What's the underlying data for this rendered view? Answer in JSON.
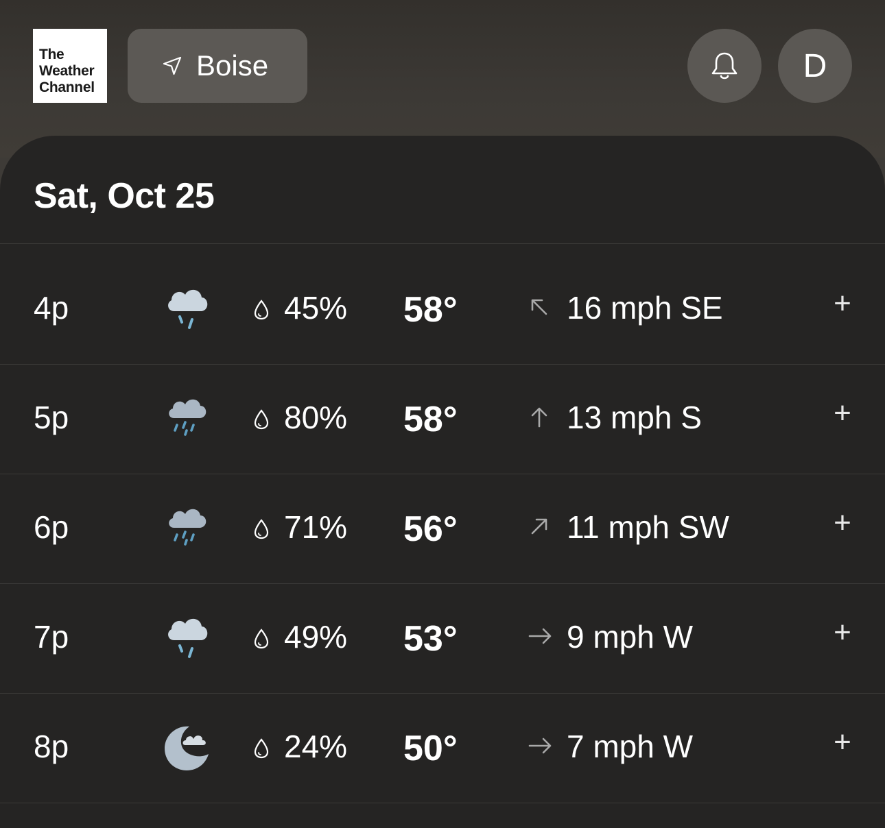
{
  "header": {
    "logo_lines": [
      "The",
      "Weather",
      "Channel"
    ],
    "location": "Boise",
    "avatar_initial": "D"
  },
  "forecast": {
    "date": "Sat, Oct 25",
    "rows": [
      {
        "time": "4p",
        "icon": "light-rain-icon",
        "precip": "45%",
        "temp": "58°",
        "wind": "16 mph SE",
        "wind_arrow": "northwest-arrow-icon"
      },
      {
        "time": "5p",
        "icon": "rain-icon",
        "precip": "80%",
        "temp": "58°",
        "wind": "13 mph S",
        "wind_arrow": "north-arrow-icon"
      },
      {
        "time": "6p",
        "icon": "rain-icon",
        "precip": "71%",
        "temp": "56°",
        "wind": "11 mph SW",
        "wind_arrow": "northeast-arrow-icon"
      },
      {
        "time": "7p",
        "icon": "light-rain-icon",
        "precip": "49%",
        "temp": "53°",
        "wind": "9 mph W",
        "wind_arrow": "east-arrow-icon"
      },
      {
        "time": "8p",
        "icon": "partly-cloudy-night-icon",
        "precip": "24%",
        "temp": "50°",
        "wind": "7 mph W",
        "wind_arrow": "east-arrow-icon"
      }
    ],
    "expand_label": "+"
  },
  "colors": {
    "background": "#3e3b37",
    "card": "#252423",
    "rain_drop": "#6aa9c9",
    "cloud": "#b8c4cf"
  }
}
